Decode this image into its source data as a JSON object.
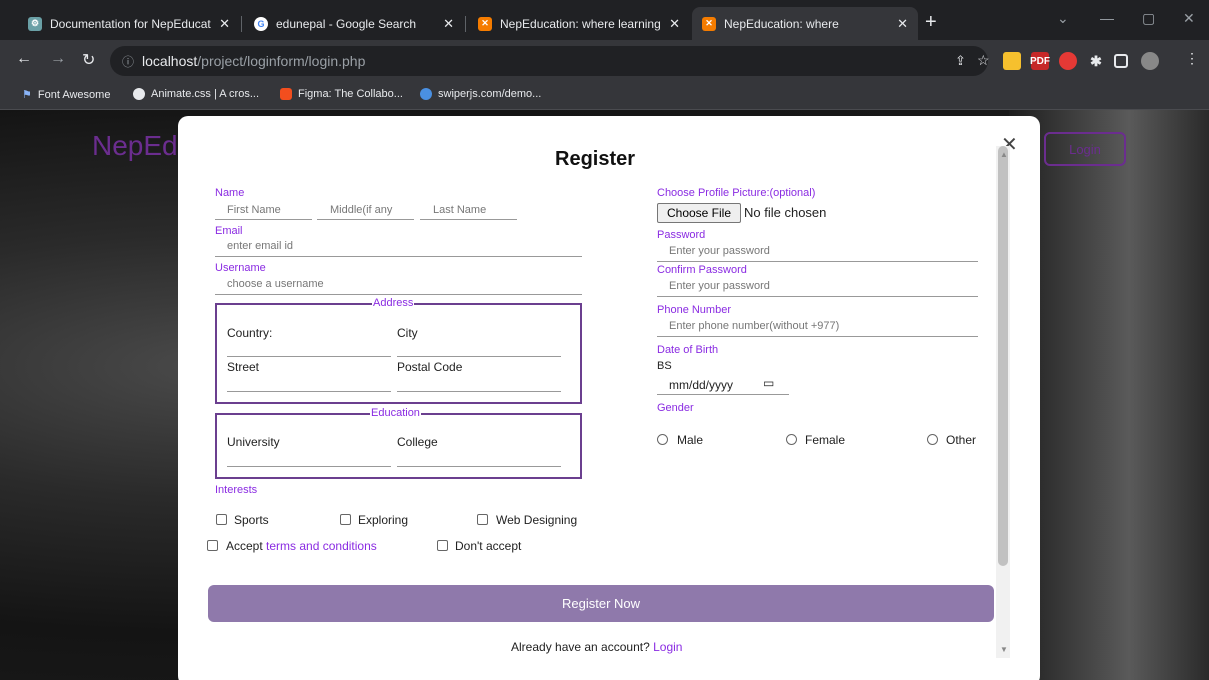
{
  "browser": {
    "tabs": [
      {
        "title": "Documentation for NepEducatior",
        "favicon": "gear-icon"
      },
      {
        "title": "edunepal - Google Search",
        "favicon": "google-icon"
      },
      {
        "title": "NepEducation: where learning ar",
        "favicon": "xampp-icon"
      },
      {
        "title": "NepEducation: where",
        "favicon": "xampp-icon"
      }
    ],
    "url_host": "localhost",
    "url_path": "/project/loginform/login.php",
    "bookmarks": [
      "Font Awesome",
      "Animate.css | A cros...",
      "Figma: The Collabo...",
      "swiperjs.com/demo..."
    ]
  },
  "page": {
    "brand": "NepEd",
    "login_button": "Login"
  },
  "form": {
    "title": "Register",
    "name_label": "Name",
    "first_name_ph": "First Name",
    "middle_name_ph": "Middle(if any",
    "last_name_ph": "Last Name",
    "email_label": "Email",
    "email_ph": "enter email id",
    "username_label": "Username",
    "username_ph": "choose a username",
    "address_legend": "Address",
    "country_label": "Country:",
    "city_label": "City",
    "street_label": "Street",
    "postal_label": "Postal Code",
    "education_legend": "Education",
    "university_label": "University",
    "college_label": "College",
    "interests_label": "Interests",
    "interests": [
      "Sports",
      "Exploring",
      "Web Designing"
    ],
    "accept_prefix": "Accept ",
    "accept_link": "terms and conditions",
    "dont_accept": "Don't accept",
    "profile_label": "Choose Profile Picture:(optional)",
    "choose_file": "Choose File",
    "no_file": "No file chosen",
    "password_label": "Password",
    "password_ph": "Enter your password",
    "confirm_label": "Confirm Password",
    "confirm_ph": "Enter your password",
    "phone_label": "Phone Number",
    "phone_ph": "Enter phone number(without +977)",
    "dob_label": "Date of Birth",
    "dob_calendar": "BS",
    "dob_ph": "mm/dd/yyyy",
    "gender_label": "Gender",
    "genders": [
      "Male",
      "Female",
      "Other"
    ],
    "register_button": "Register Now",
    "already_text": "Already have an account? ",
    "already_link": "Login"
  },
  "colors": {
    "accent": "#8a2be2",
    "button": "#8f79ab",
    "border": "#6b3f8f"
  }
}
